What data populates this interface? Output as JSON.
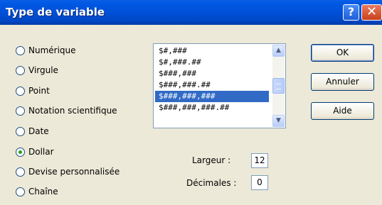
{
  "window": {
    "title": "Type de variable",
    "help_glyph": "?",
    "close_glyph": "✕"
  },
  "radios": [
    {
      "label": "Numérique",
      "checked": false
    },
    {
      "label": "Virgule",
      "checked": false
    },
    {
      "label": "Point",
      "checked": false
    },
    {
      "label": "Notation scientifique",
      "checked": false
    },
    {
      "label": "Date",
      "checked": false
    },
    {
      "label": "Dollar",
      "checked": true
    },
    {
      "label": "Devise personnalisée",
      "checked": false
    },
    {
      "label": "Chaîne",
      "checked": false
    }
  ],
  "format_list": {
    "items": [
      "$#,###",
      "$#,###.##",
      "$###,###",
      "$###,###.##",
      "$###,###,###",
      "$###,###,###.##"
    ],
    "selected": "$###,###,###",
    "scroll_up": "▲",
    "scroll_down": "▼"
  },
  "buttons": {
    "ok": "OK",
    "cancel": "Annuler",
    "help": "Aide"
  },
  "fields": {
    "width_label": "Largeur :",
    "width_value": "12",
    "decimals_label": "Décimales :",
    "decimals_value": "0"
  },
  "colors": {
    "titlebar": "#0054e3",
    "selection": "#316ac5",
    "dialog_bg": "#ece9d8"
  }
}
